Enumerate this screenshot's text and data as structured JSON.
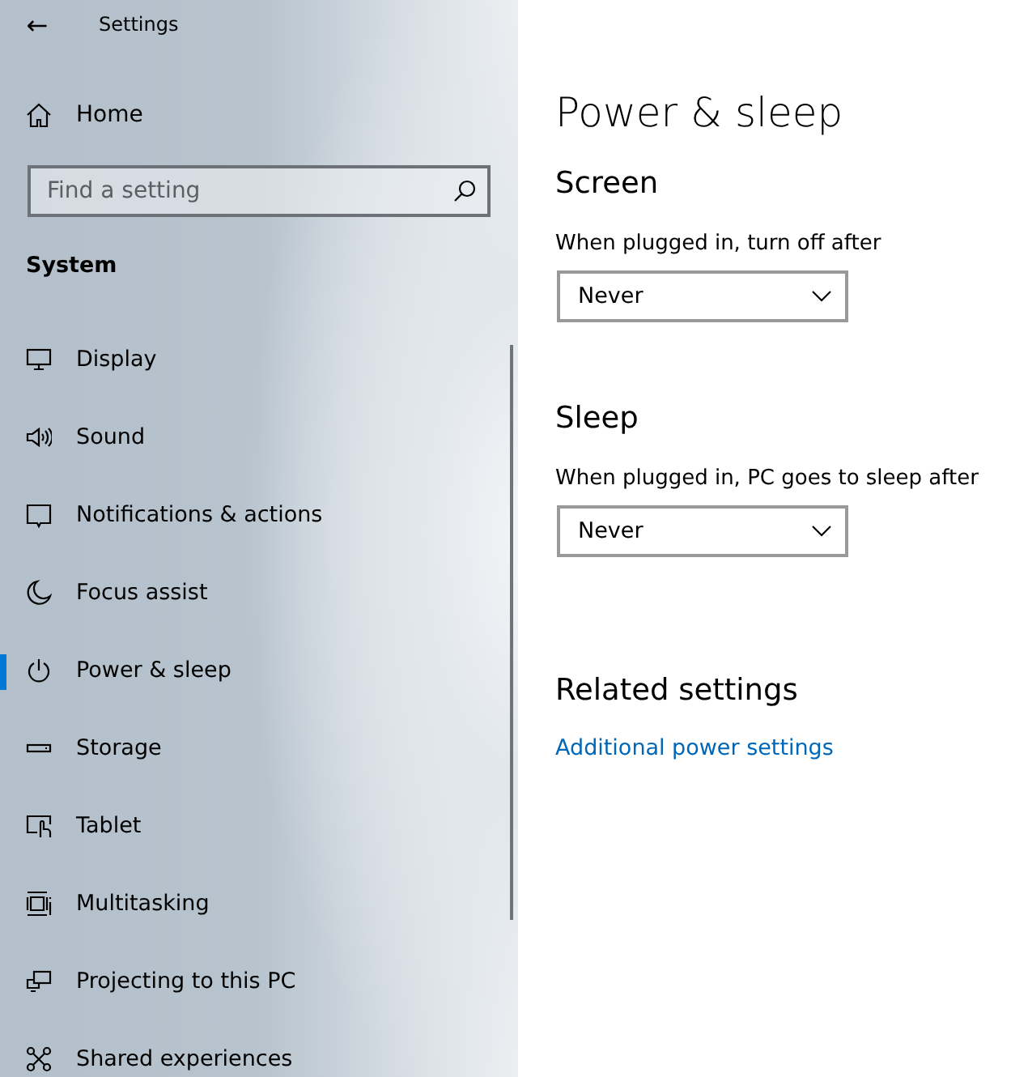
{
  "window": {
    "title": "Settings",
    "back": "←"
  },
  "sidebar": {
    "home": "Home",
    "search": {
      "placeholder": "Find a setting"
    },
    "section": "System",
    "items": [
      {
        "label": "Display",
        "selected": false
      },
      {
        "label": "Sound",
        "selected": false
      },
      {
        "label": "Notifications & actions",
        "selected": false
      },
      {
        "label": "Focus assist",
        "selected": false
      },
      {
        "label": "Power & sleep",
        "selected": true
      },
      {
        "label": "Storage",
        "selected": false
      },
      {
        "label": "Tablet",
        "selected": false
      },
      {
        "label": "Multitasking",
        "selected": false
      },
      {
        "label": "Projecting to this PC",
        "selected": false
      },
      {
        "label": "Shared experiences",
        "selected": false
      }
    ]
  },
  "page": {
    "title": "Power & sleep",
    "sections": [
      {
        "heading": "Screen",
        "label": "When plugged in, turn off after",
        "value": "Never"
      },
      {
        "heading": "Sleep",
        "label": "When plugged in, PC goes to sleep after",
        "value": "Never"
      }
    ],
    "related": {
      "heading": "Related settings",
      "link": "Additional power settings"
    }
  }
}
